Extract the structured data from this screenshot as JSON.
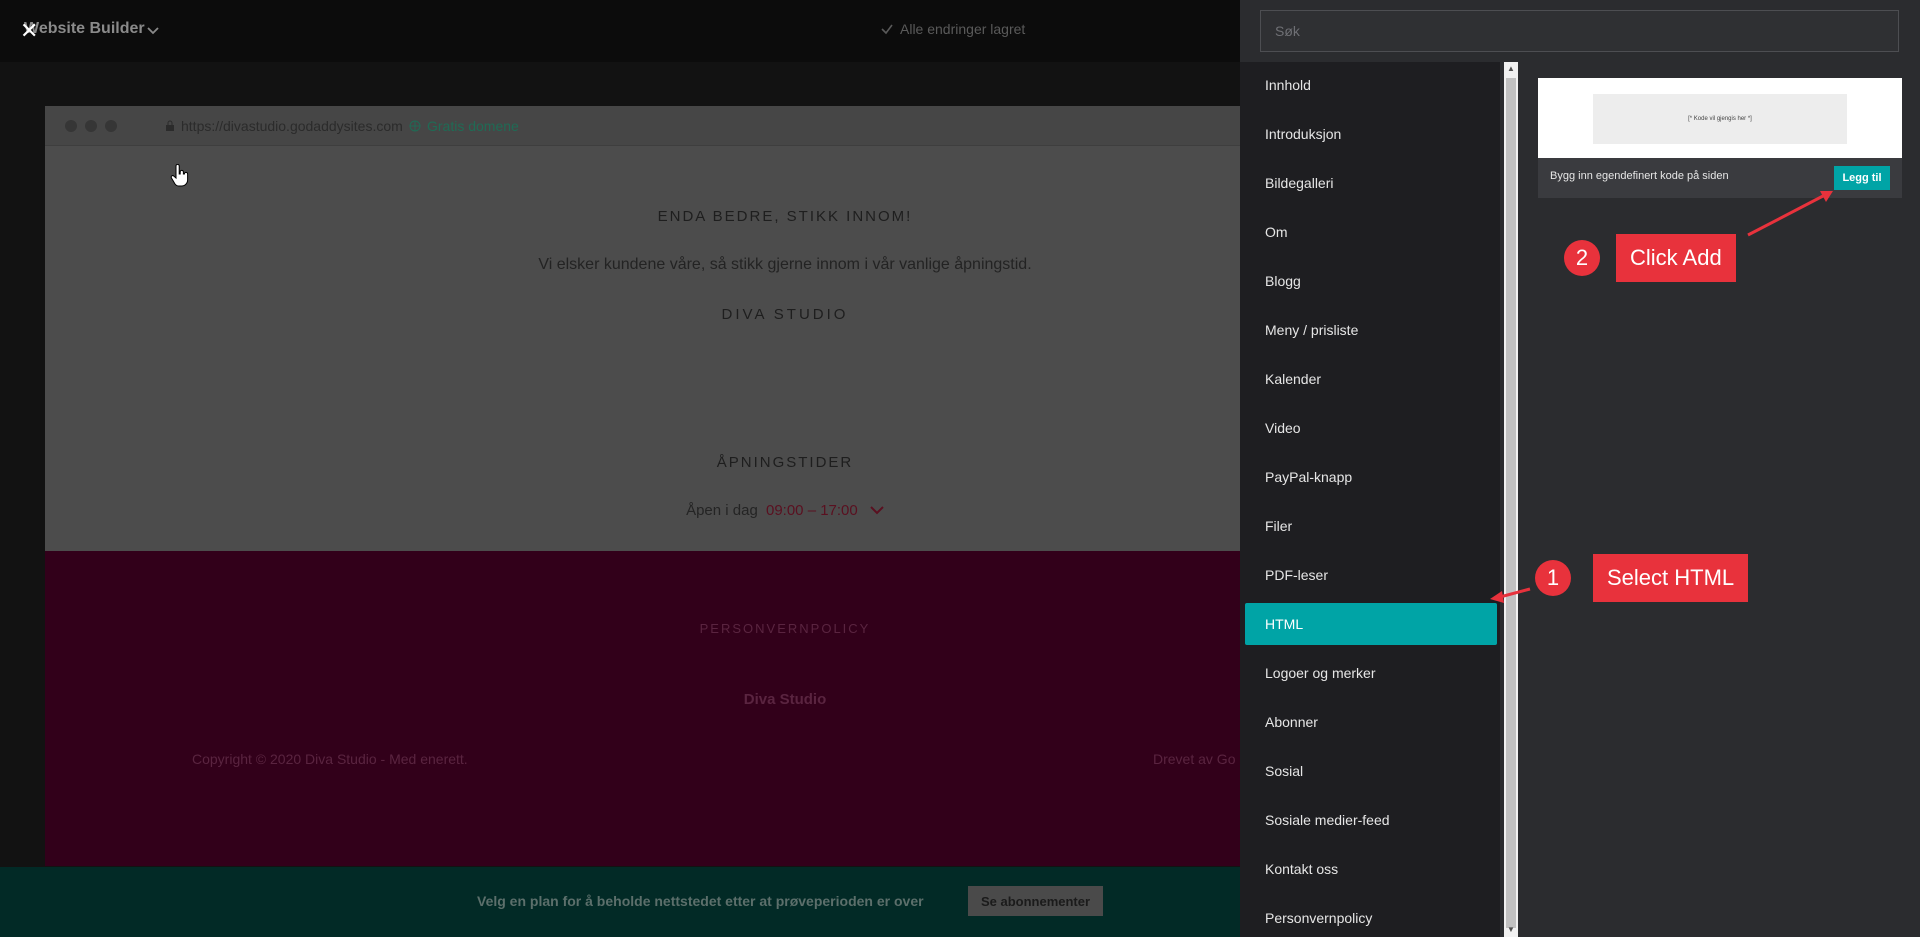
{
  "app": {
    "close_glyph": "✕",
    "title": "Website Builder",
    "saved_status": "Alle endringer lagret"
  },
  "browser": {
    "url": "https://divastudio.godaddysites.com",
    "free_domain": "Gratis domene"
  },
  "site": {
    "heading": "ENDA BEDRE, STIKK INNOM!",
    "text": "Vi elsker kundene våre, så stikk gjerne innom i vår vanlige åpningstid.",
    "business": "DIVA STUDIO",
    "hours_heading": "ÅPNINGSTIDER",
    "hours_label": "Åpen i dag",
    "hours_value": "09:00 – 17:00"
  },
  "footer": {
    "policy": "PERSONVERNPOLICY",
    "name": "Diva Studio",
    "copyright": "Copyright © 2020 Diva Studio - Med enerett.",
    "powered": "Drevet av Go"
  },
  "trial": {
    "text": "Velg en plan for å beholde nettstedet etter at prøveperioden er over",
    "button": "Se abonnementer"
  },
  "panel": {
    "search_placeholder": "Søk",
    "categories": [
      {
        "label": "Innhold"
      },
      {
        "label": "Introduksjon"
      },
      {
        "label": "Bildegalleri"
      },
      {
        "label": "Om"
      },
      {
        "label": "Blogg"
      },
      {
        "label": "Meny / prisliste"
      },
      {
        "label": "Kalender"
      },
      {
        "label": "Video"
      },
      {
        "label": "PayPal-knapp"
      },
      {
        "label": "Filer"
      },
      {
        "label": "PDF-leser"
      },
      {
        "label": "HTML",
        "active": true
      },
      {
        "label": "Logoer og merker"
      },
      {
        "label": "Abonner"
      },
      {
        "label": "Sosial"
      },
      {
        "label": "Sosiale medier-feed"
      },
      {
        "label": "Kontakt oss"
      },
      {
        "label": "Personvernpolicy"
      }
    ],
    "card": {
      "code_text": "[* Kode vil gjengis her *]",
      "description": "Bygg inn egendefinert kode på siden",
      "add_button": "Legg til"
    }
  },
  "annotations": [
    {
      "number": "1",
      "label": "Select HTML"
    },
    {
      "number": "2",
      "label": "Click Add"
    }
  ],
  "colors": {
    "accent": "#00a4a6",
    "annotation": "#e8323c",
    "footer": "#32001a"
  }
}
